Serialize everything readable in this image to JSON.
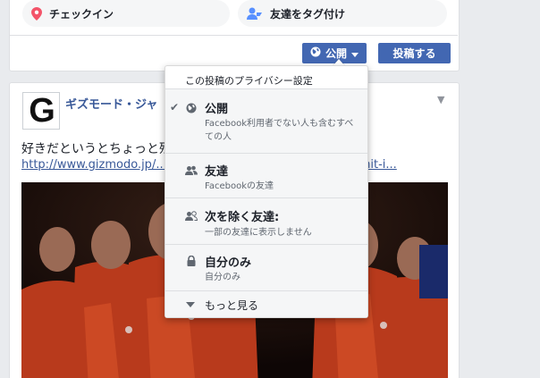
{
  "composer": {
    "checkin_label": "チェックイン",
    "tag_friends_label": "友達をタグ付け",
    "privacy_button_label": "公開",
    "post_button_label": "投稿する"
  },
  "post": {
    "page_logo_letter": "G",
    "page_name": "ギズモード・ジャ",
    "text": "好きだというとちょっと残",
    "link_start": "http://www.gizmodo.jp/...",
    "link_end": "mit-i..."
  },
  "privacy_menu": {
    "header": "この投稿のプライバシー設定",
    "options": [
      {
        "label": "公開",
        "description": "Facebook利用者でない人も含むすべての人",
        "icon": "globe-icon",
        "selected": true
      },
      {
        "label": "友達",
        "description": "Facebookの友達",
        "icon": "friends-icon",
        "selected": false
      },
      {
        "label": "次を除く友達:",
        "description": "一部の友達に表示しません",
        "icon": "friends-except-icon",
        "selected": false
      },
      {
        "label": "自分のみ",
        "description": "自分のみ",
        "icon": "lock-icon",
        "selected": false
      }
    ],
    "more_label": "もっと見る"
  },
  "colors": {
    "accent": "#4267b2",
    "link": "#385898",
    "background": "#e9ebee"
  }
}
